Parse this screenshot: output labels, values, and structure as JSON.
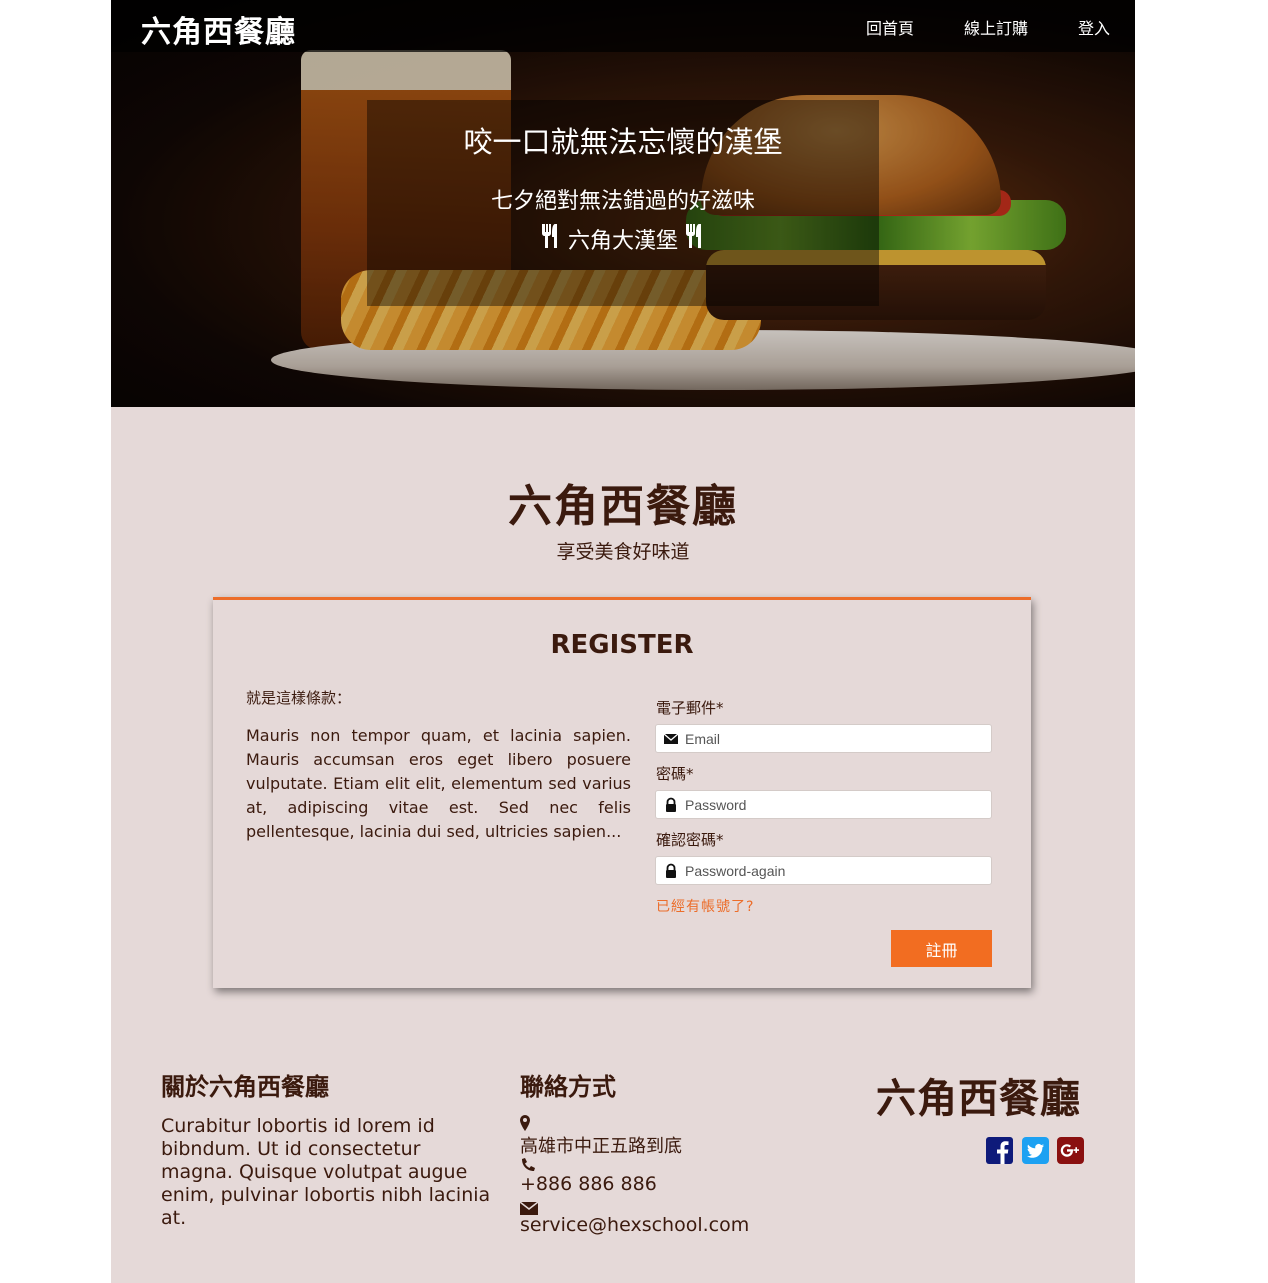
{
  "nav": {
    "brand": "六角西餐廳",
    "links": [
      "回首頁",
      "線上訂購",
      "登入"
    ]
  },
  "hero": {
    "title": "咬一口就無法忘懷的漢堡",
    "subtitle": "七夕絕對無法錯過的好滋味",
    "tagline": "六角大漢堡",
    "tagline_icon": "fork-knife-icon"
  },
  "main": {
    "title": "六角西餐廳",
    "subtitle": "享受美食好味道"
  },
  "register": {
    "title": "REGISTER",
    "terms_label": "就是這樣條款：",
    "terms_body": "Mauris non tempor quam, et lacinia sapien. Mauris accumsan eros eget libero posuere vulputate. Etiam elit elit, elementum sed varius at, adipiscing vitae est. Sed nec felis pellentesque, lacinia dui sed, ultricies sapien...",
    "email_label": "電子郵件*",
    "email_placeholder": "Email",
    "password_label": "密碼*",
    "password_placeholder": "Password",
    "confirm_label": "確認密碼*",
    "confirm_placeholder": "Password-again",
    "have_account": "已經有帳號了?",
    "submit_label": "註冊"
  },
  "footer": {
    "about_title": "關於六角西餐廳",
    "about_text": "Curabitur lobortis id lorem id bibndum. Ut id consectetur magna. Quisque volutpat augue enim, pulvinar lobortis nibh lacinia at.",
    "contact_title": "聯絡方式",
    "address": "高雄市中正五路到底",
    "phone": "+886 886 886",
    "email": "service@hexschool.com",
    "brand": "六角西餐廳",
    "social": [
      "facebook-icon",
      "twitter-icon",
      "google-plus-icon"
    ]
  },
  "colors": {
    "accent": "#f26d21",
    "text": "#3b1a0e",
    "background": "#e5d9d8",
    "facebook": "#0e1a7a",
    "twitter": "#1da1f2",
    "google_plus": "#8a1010"
  }
}
